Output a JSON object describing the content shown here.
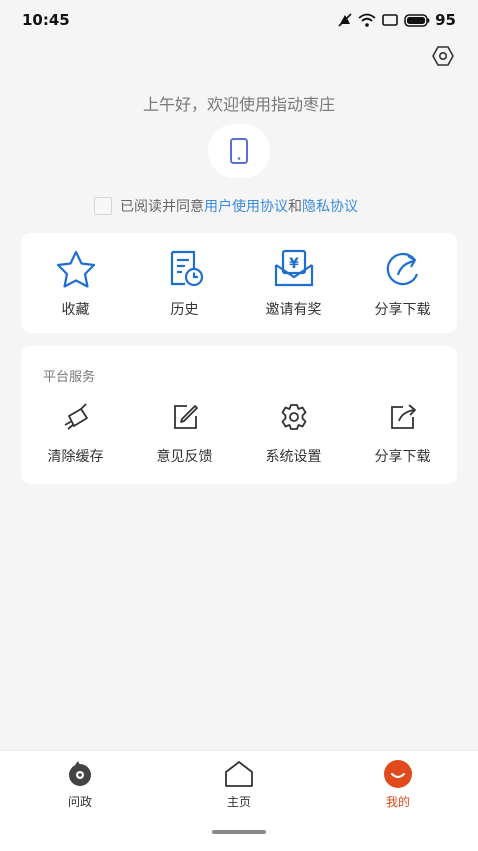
{
  "status_bar": {
    "time": "10:45",
    "battery": "95",
    "icons": [
      "mute-icon",
      "wifi-icon",
      "screen-icon",
      "battery-icon"
    ]
  },
  "header": {
    "settings_icon": "hexagon-gear-icon",
    "greeting": "上午好，欢迎使用指动枣庄",
    "login_icon": "phone-icon"
  },
  "agreement": {
    "prefix": "已阅读并同意",
    "user_agreement": "用户使用协议",
    "conjunction": "和",
    "privacy_agreement": "隐私协议"
  },
  "quick_actions": [
    {
      "label": "收藏",
      "icon": "star-icon"
    },
    {
      "label": "历史",
      "icon": "history-icon"
    },
    {
      "label": "邀请有奖",
      "icon": "invite-envelope-icon"
    },
    {
      "label": "分享下载",
      "icon": "share-arrow-icon"
    }
  ],
  "services": {
    "title": "平台服务",
    "items": [
      {
        "label": "清除缓存",
        "icon": "broom-icon"
      },
      {
        "label": "意见反馈",
        "icon": "edit-icon"
      },
      {
        "label": "系统设置",
        "icon": "gear-icon"
      },
      {
        "label": "分享下载",
        "icon": "share-icon"
      }
    ]
  },
  "tabbar": {
    "tabs": [
      {
        "label": "问政",
        "icon": "question-bubble-icon"
      },
      {
        "label": "主页",
        "icon": "home-icon"
      },
      {
        "label": "我的",
        "icon": "profile-icon"
      }
    ],
    "active_color": "#e04a1c"
  },
  "colors": {
    "accent": "#1f6fd1",
    "link": "#3a8be0",
    "background": "#f5f5f5"
  }
}
